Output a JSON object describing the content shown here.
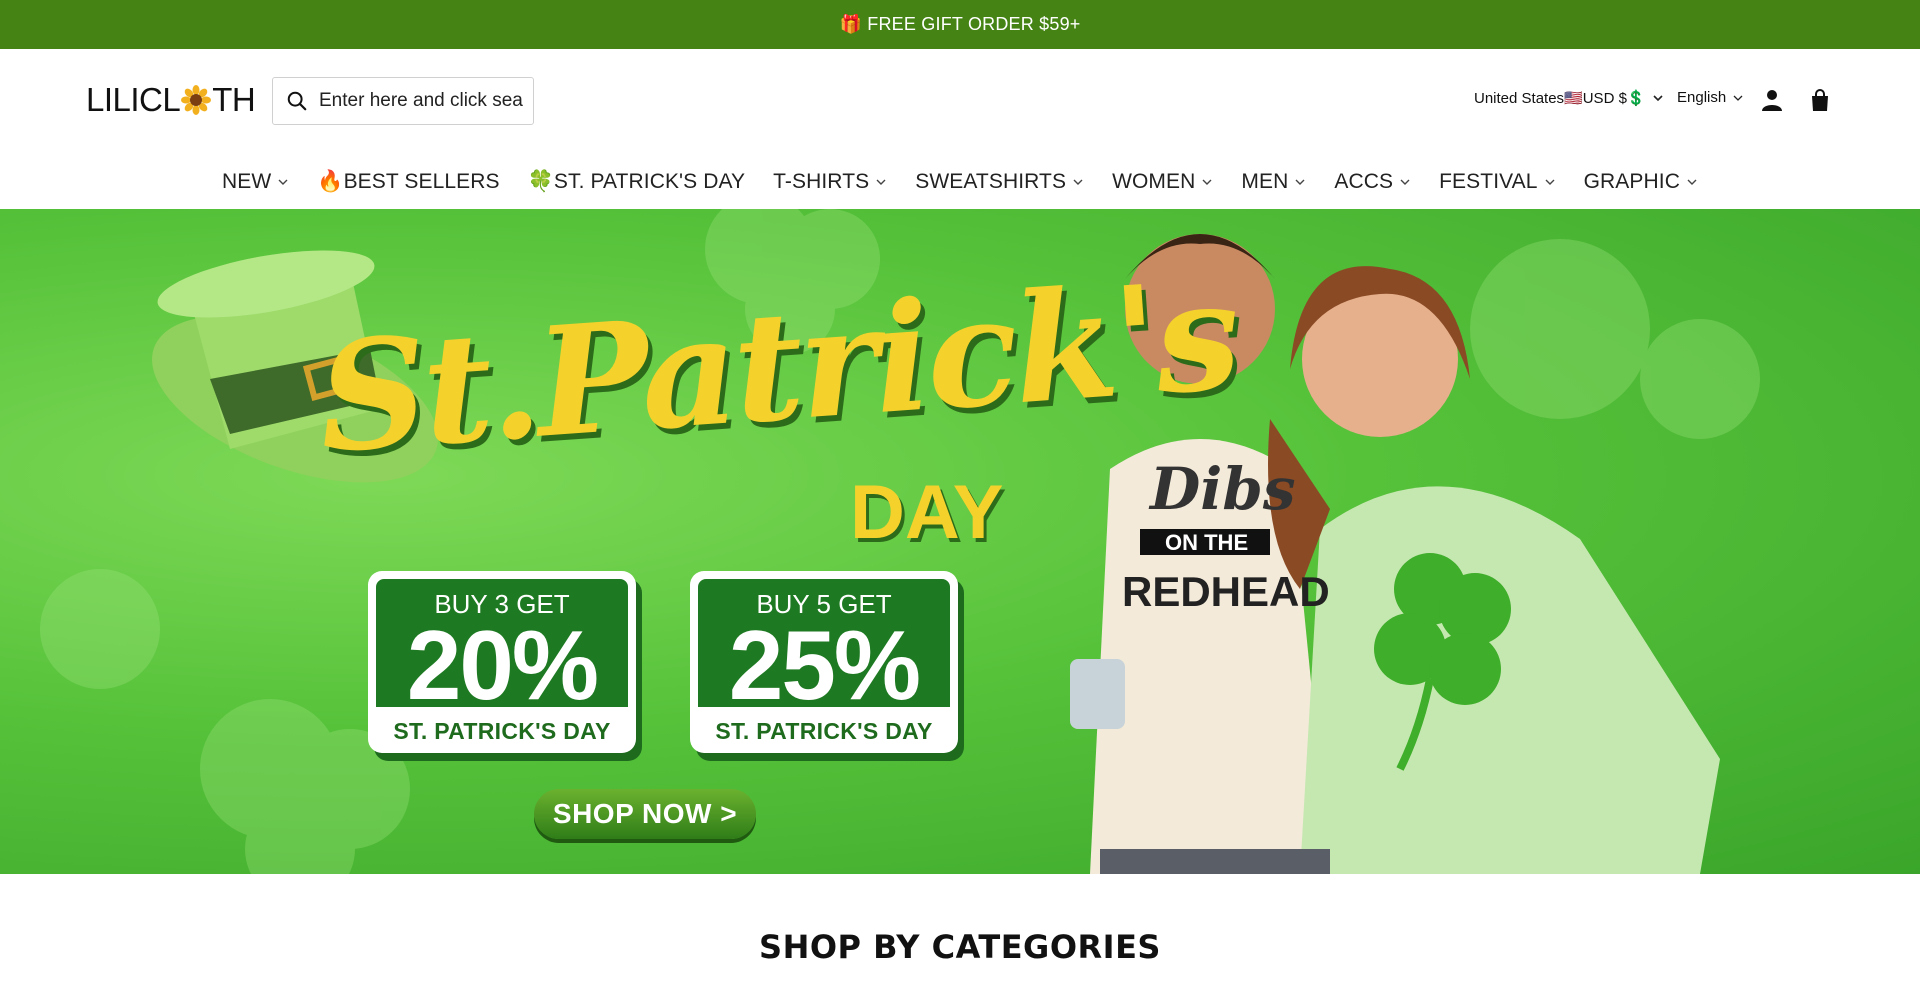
{
  "announcement": {
    "text": "🎁 FREE GIFT ORDER $59+"
  },
  "header": {
    "logo_left": "LILICL",
    "logo_right": "TH",
    "search": {
      "placeholder": "Enter here and click search"
    },
    "locale": "United States🇺🇸USD $💲",
    "language": "English",
    "icons": [
      "search-icon",
      "account-icon",
      "cart-icon",
      "chevron-down-icon",
      "sunflower-icon"
    ]
  },
  "nav": {
    "items": [
      {
        "label": "NEW",
        "dropdown": true
      },
      {
        "label": "🔥BEST SELLERS",
        "dropdown": false
      },
      {
        "label": "🍀ST. PATRICK'S DAY",
        "dropdown": false
      },
      {
        "label": "T-SHIRTS",
        "dropdown": true
      },
      {
        "label": "SWEATSHIRTS",
        "dropdown": true
      },
      {
        "label": "WOMEN",
        "dropdown": true
      },
      {
        "label": "MEN",
        "dropdown": true
      },
      {
        "label": "ACCS",
        "dropdown": true
      },
      {
        "label": "FESTIVAL",
        "dropdown": true
      },
      {
        "label": "GRAPHIC",
        "dropdown": true
      }
    ]
  },
  "hero": {
    "title": "St.Patrick's",
    "subtitle": "DAY",
    "promos": [
      {
        "buy": "BUY 3 GET",
        "percent": "20%",
        "footer": "ST. PATRICK'S DAY"
      },
      {
        "buy": "BUY 5 GET",
        "percent": "25%",
        "footer": "ST. PATRICK'S DAY"
      }
    ],
    "cta": "SHOP NOW >",
    "shirt_text": [
      "Dibs",
      "ON THE",
      "REDHEAD"
    ],
    "colors": {
      "background": "#56c23a",
      "title": "#f5d22b",
      "promo_green": "#1e7a22"
    }
  },
  "section": {
    "title": "SHOP BY CATEGORIES"
  },
  "colors": {
    "announcement_bg": "#458414"
  }
}
